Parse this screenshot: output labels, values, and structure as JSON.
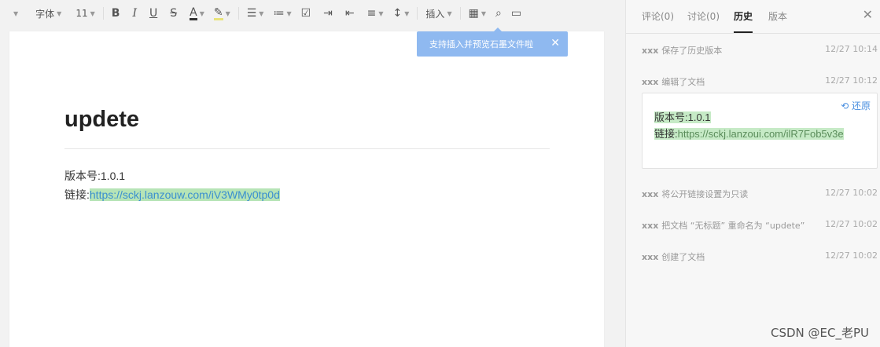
{
  "toolbar": {
    "font_label": "字体",
    "size_label": "11",
    "insert_label": "插入"
  },
  "tooltip": {
    "text": "支持插入并预览石墨文件啦"
  },
  "document": {
    "title": "updete",
    "line1": "版本号:1.0.1",
    "line2_prefix": "链接:",
    "line2_link": "https://sckj.lanzouw.com/iV3WMy0tp0d"
  },
  "panel": {
    "tabs": [
      "评论(0)",
      "讨论(0)",
      "历史",
      "版本"
    ],
    "active_tab": "历史",
    "history": [
      {
        "who": "xxx",
        "action": "保存了历史版本",
        "time": "12/27 10:14"
      },
      {
        "who": "xxx",
        "action": "编辑了文档",
        "time": "12/27 10:12"
      },
      {
        "who": "xxx",
        "action": "将公开链接设置为只读",
        "time": "12/27 10:02"
      },
      {
        "who": "xxx",
        "action": "把文档 “无标题” 重命名为 “updete”",
        "time": "12/27 10:02"
      },
      {
        "who": "xxx",
        "action": "创建了文档",
        "time": "12/27 10:02"
      }
    ],
    "card": {
      "restore_label": "还原",
      "l1_prefix": "版本号:",
      "l1_value": "1.0.1",
      "l2_prefix": "链接:",
      "l2_link": "https://sckj.lanzoui.com/ilR7Fob5v3e"
    }
  },
  "watermark": "CSDN @EC_老PU"
}
